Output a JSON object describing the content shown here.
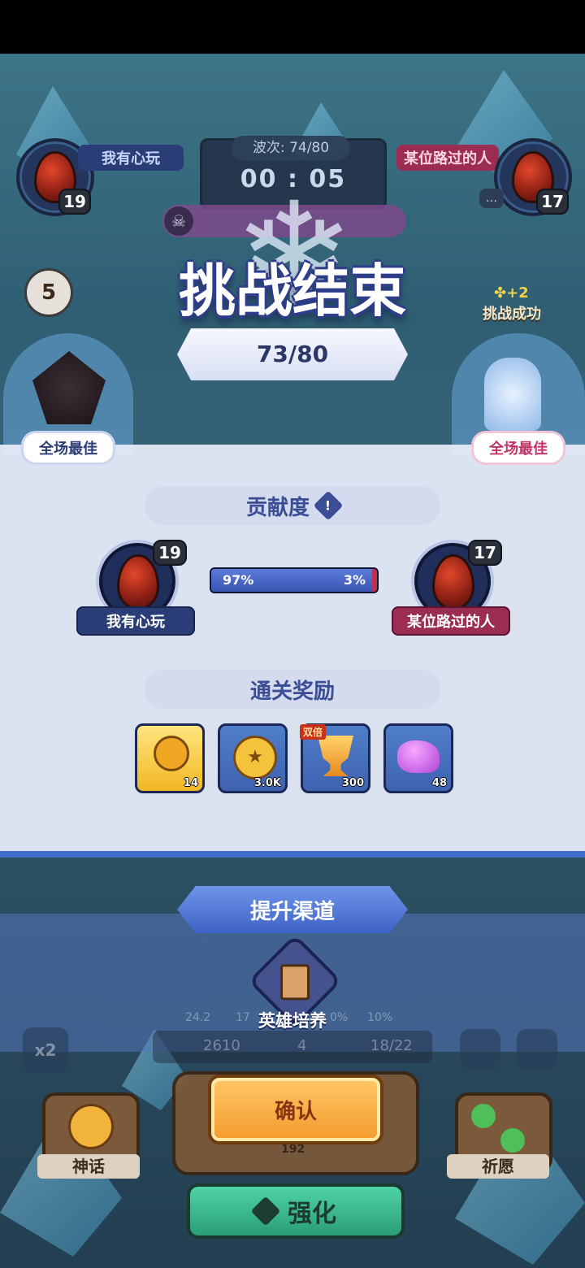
{
  "hud": {
    "left_player": {
      "name": "我有心玩",
      "level": "19"
    },
    "right_player": {
      "name": "某位路过的人",
      "level": "17"
    },
    "wave": "波次: 74/80",
    "timer": "00 : 05",
    "left_badge_number": "5",
    "right_bonus": "+2",
    "right_status": "挑战成功"
  },
  "result": {
    "title": "挑战结束",
    "score": "73/80",
    "best_left": "全场最佳",
    "best_right": "全场最佳"
  },
  "contribution": {
    "header": "贡献度",
    "left_percent": "97%",
    "right_percent": "3%",
    "left_fraction": 0.97,
    "left_name": "我有心玩",
    "left_level": "19",
    "right_name": "某位路过的人",
    "right_level": "17"
  },
  "rewards": {
    "header": "通关奖励",
    "items": [
      {
        "icon": "key-icon",
        "count": "14"
      },
      {
        "icon": "coin-icon",
        "count": "3.0K"
      },
      {
        "icon": "trophy-icon",
        "count": "300",
        "tag": "双倍"
      },
      {
        "icon": "crystal-icon",
        "count": "48"
      }
    ]
  },
  "improve": {
    "banner": "提升渠道",
    "hero_label": "英雄培养"
  },
  "bottom": {
    "confirm": "确认",
    "strengthen": "强化",
    "myth": "神话",
    "wish": "祈愿",
    "faded": [
      "24.2",
      "17",
      "0%",
      "10%",
      "2610",
      "4",
      "18/22",
      "192",
      "x2"
    ]
  },
  "colors": {
    "accent_blue": "#3b4d95",
    "accent_red": "#c33366",
    "confirm_orange": "#f39a2b"
  }
}
